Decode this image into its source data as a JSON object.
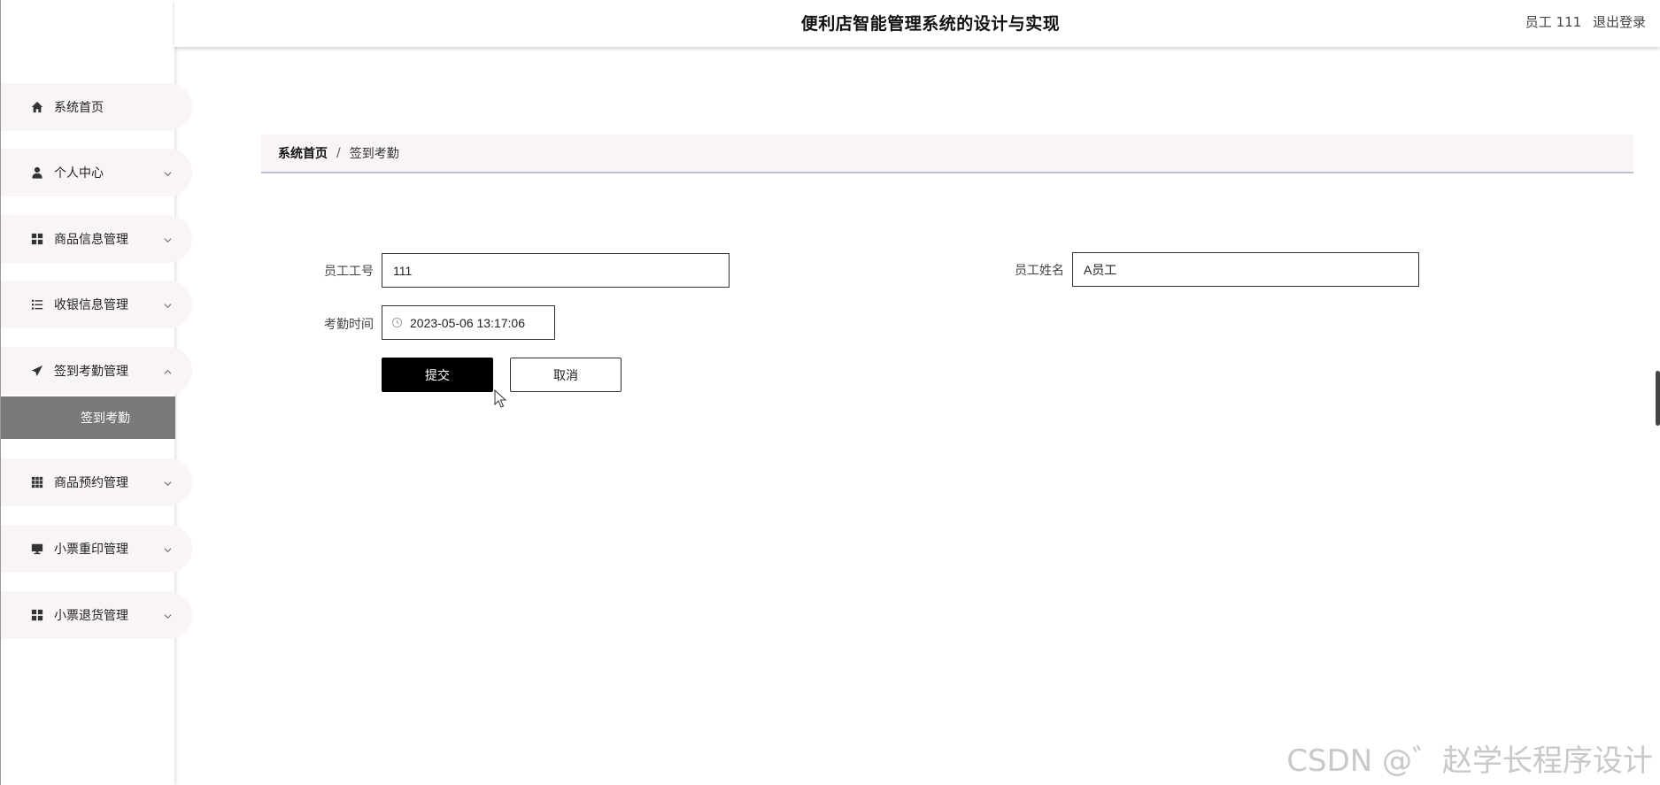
{
  "header": {
    "title": "便利店智能管理系统的设计与实现",
    "user_label": "员工 111",
    "logout_label": "退出登录"
  },
  "sidebar": {
    "items": [
      {
        "label": "系统首页",
        "icon": "home-icon",
        "has_chevron": false
      },
      {
        "label": "个人中心",
        "icon": "user-icon",
        "has_chevron": true
      },
      {
        "label": "商品信息管理",
        "icon": "grid-icon",
        "has_chevron": true
      },
      {
        "label": "收银信息管理",
        "icon": "list-icon",
        "has_chevron": true
      },
      {
        "label": "签到考勤管理",
        "icon": "send-icon",
        "has_chevron": true,
        "expanded": true
      },
      {
        "label": "商品预约管理",
        "icon": "apps-icon",
        "has_chevron": true
      },
      {
        "label": "小票重印管理",
        "icon": "monitor-icon",
        "has_chevron": true
      },
      {
        "label": "小票退货管理",
        "icon": "grid-icon",
        "has_chevron": true
      }
    ],
    "active_sub_item": "签到考勤"
  },
  "breadcrumb": {
    "home": "系统首页",
    "separator": "/",
    "current": "签到考勤"
  },
  "form": {
    "employee_id_label": "员工工号",
    "employee_id_value": "111",
    "employee_name_label": "员工姓名",
    "employee_name_value": "A员工",
    "attendance_time_label": "考勤时间",
    "attendance_time_value": "2023-05-06 13:17:06",
    "submit_label": "提交",
    "cancel_label": "取消"
  },
  "watermark": "CSDN @゛赵学长程序设计",
  "colors": {
    "menu_bg": "#f8f4f7",
    "submenu_active_bg": "#7a7a7a",
    "primary_button": "#000000"
  }
}
